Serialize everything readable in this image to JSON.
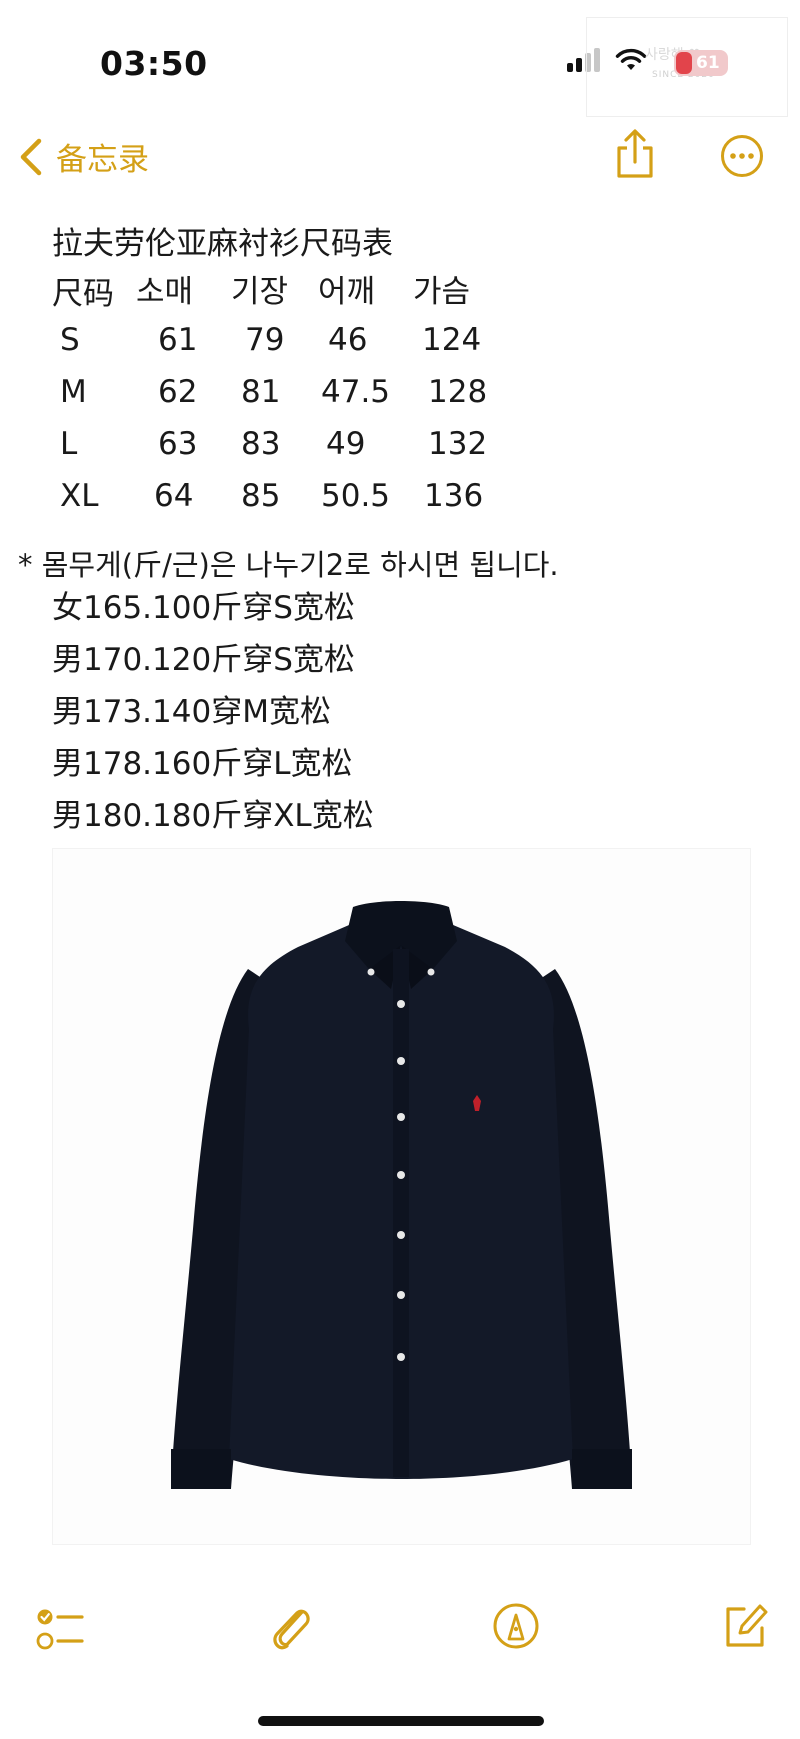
{
  "status_bar": {
    "time": "03:50",
    "battery_level": "61",
    "watermark_text": "사랑해 ♥",
    "watermark_since": "SINCE 2020"
  },
  "nav": {
    "back_label": "备忘录",
    "back_icon": "chevron-left-icon",
    "share_icon": "share-icon",
    "more_icon": "ellipsis-circle-icon",
    "accent_color": "#d4a017"
  },
  "note": {
    "title": "拉夫劳伦亚麻衬衫尺码表",
    "size_table": {
      "headers": [
        "尺码",
        "소매",
        "기장",
        "어깨",
        "가슴"
      ],
      "rows": [
        [
          "S",
          "61",
          "79",
          "46",
          "124"
        ],
        [
          "M",
          "62",
          "81",
          "47.5",
          "128"
        ],
        [
          "L",
          "63",
          "83",
          "49",
          "132"
        ],
        [
          "XL",
          "64",
          "85",
          "50.5",
          "136"
        ]
      ]
    },
    "weight_note": "* 몸무게(斤/근)은 나누기2로 하시면 됩니다.",
    "fit_lines": [
      "女165.100斤穿S宽松",
      "男170.120斤穿S宽松",
      "男173.140穿M宽松",
      "男178.160斤穿L宽松",
      "男180.180斤穿XL宽松"
    ]
  },
  "toolbar": {
    "checklist_icon": "checklist-icon",
    "attachment_icon": "paperclip-icon",
    "markup_icon": "pen-circle-icon",
    "compose_icon": "compose-icon"
  }
}
